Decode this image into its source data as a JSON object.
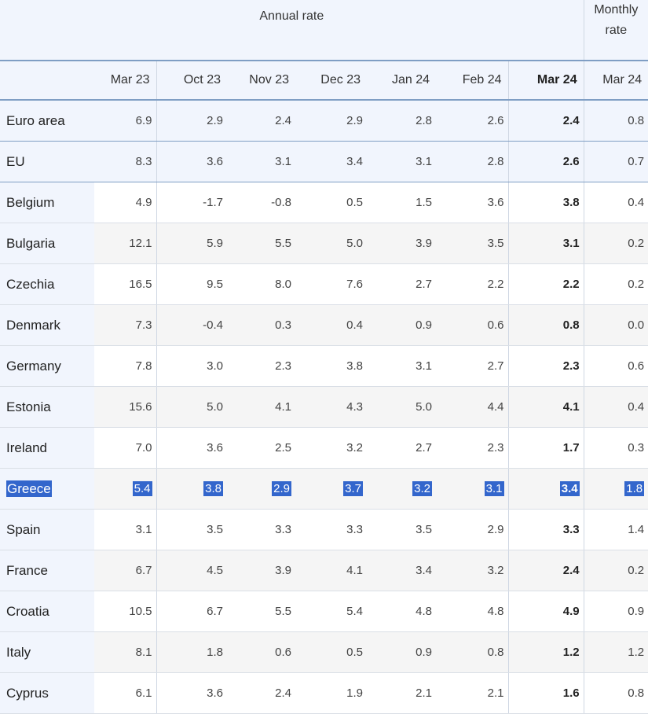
{
  "header": {
    "annual_label": "Annual rate",
    "monthly_label_line1": "Monthly",
    "monthly_label_line2": "rate",
    "months": [
      "Mar 23",
      "Oct 23",
      "Nov 23",
      "Dec 23",
      "Jan 24",
      "Feb 24",
      "Mar 24",
      "Mar 24"
    ]
  },
  "rows": [
    {
      "label": "Euro area",
      "values": [
        "6.9",
        "2.9",
        "2.4",
        "2.9",
        "2.8",
        "2.6",
        "2.4",
        "0.8"
      ]
    },
    {
      "label": "EU",
      "values": [
        "8.3",
        "3.6",
        "3.1",
        "3.4",
        "3.1",
        "2.8",
        "2.6",
        "0.7"
      ]
    },
    {
      "label": "Belgium",
      "values": [
        "4.9",
        "-1.7",
        "-0.8",
        "0.5",
        "1.5",
        "3.6",
        "3.8",
        "0.4"
      ]
    },
    {
      "label": "Bulgaria",
      "values": [
        "12.1",
        "5.9",
        "5.5",
        "5.0",
        "3.9",
        "3.5",
        "3.1",
        "0.2"
      ]
    },
    {
      "label": "Czechia",
      "values": [
        "16.5",
        "9.5",
        "8.0",
        "7.6",
        "2.7",
        "2.2",
        "2.2",
        "0.2"
      ]
    },
    {
      "label": "Denmark",
      "values": [
        "7.3",
        "-0.4",
        "0.3",
        "0.4",
        "0.9",
        "0.6",
        "0.8",
        "0.0"
      ]
    },
    {
      "label": "Germany",
      "values": [
        "7.8",
        "3.0",
        "2.3",
        "3.8",
        "3.1",
        "2.7",
        "2.3",
        "0.6"
      ]
    },
    {
      "label": "Estonia",
      "values": [
        "15.6",
        "5.0",
        "4.1",
        "4.3",
        "5.0",
        "4.4",
        "4.1",
        "0.4"
      ]
    },
    {
      "label": "Ireland",
      "values": [
        "7.0",
        "3.6",
        "2.5",
        "3.2",
        "2.7",
        "2.3",
        "1.7",
        "0.3"
      ]
    },
    {
      "label": "Greece",
      "values": [
        "5.4",
        "3.8",
        "2.9",
        "3.7",
        "3.2",
        "3.1",
        "3.4",
        "1.8"
      ]
    },
    {
      "label": "Spain",
      "values": [
        "3.1",
        "3.5",
        "3.3",
        "3.3",
        "3.5",
        "2.9",
        "3.3",
        "1.4"
      ]
    },
    {
      "label": "France",
      "values": [
        "6.7",
        "4.5",
        "3.9",
        "4.1",
        "3.4",
        "3.2",
        "2.4",
        "0.2"
      ]
    },
    {
      "label": "Croatia",
      "values": [
        "10.5",
        "6.7",
        "5.5",
        "5.4",
        "4.8",
        "4.8",
        "4.9",
        "0.9"
      ]
    },
    {
      "label": "Italy",
      "values": [
        "8.1",
        "1.8",
        "0.6",
        "0.5",
        "0.9",
        "0.8",
        "1.2",
        "1.2"
      ]
    },
    {
      "label": "Cyprus",
      "values": [
        "6.1",
        "3.6",
        "2.4",
        "1.9",
        "2.1",
        "2.1",
        "1.6",
        "0.8"
      ]
    }
  ],
  "colors": {
    "header_bg": "#f1f5fd",
    "header_rule": "#7f9ec4",
    "selection": "#3366cc",
    "alt_row": "#f5f5f5"
  }
}
